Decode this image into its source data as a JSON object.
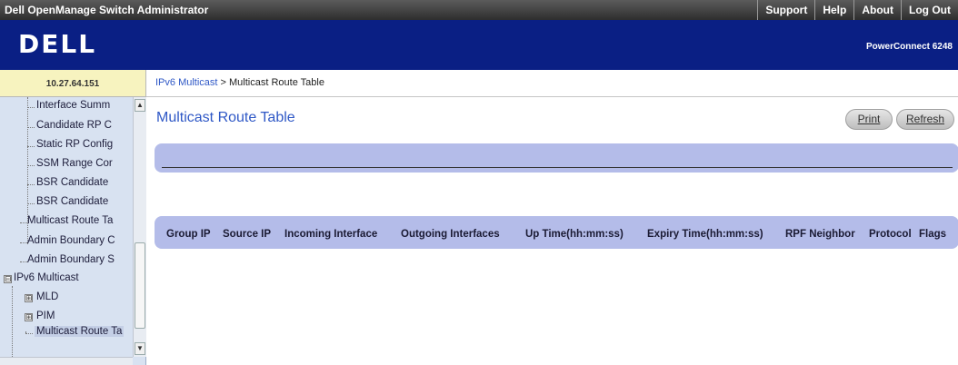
{
  "app_title": "Dell OpenManage Switch Administrator",
  "top_nav": [
    "Support",
    "Help",
    "About",
    "Log Out"
  ],
  "brand": {
    "logo": "DELL",
    "model": "PowerConnect 6248"
  },
  "ip_address": "10.27.64.151",
  "breadcrumb": {
    "parent": "IPv6 Multicast",
    "separator": " > ",
    "current": "Multicast Route Table"
  },
  "tree": {
    "items": [
      {
        "label": "Interface Summ"
      },
      {
        "label": "Candidate RP C"
      },
      {
        "label": "Static RP Config"
      },
      {
        "label": "SSM Range Cor"
      },
      {
        "label": "BSR Candidate"
      },
      {
        "label": "BSR Candidate"
      },
      {
        "label": "Multicast Route Ta"
      },
      {
        "label": "Admin Boundary C"
      },
      {
        "label": "Admin Boundary S"
      },
      {
        "label": "IPv6 Multicast",
        "expander": "⊟"
      },
      {
        "label": "MLD",
        "expander": "⊞"
      },
      {
        "label": "PIM",
        "expander": "⊞"
      },
      {
        "label": "Multicast Route Ta",
        "selected": true
      }
    ]
  },
  "main": {
    "title": "Multicast Route Table",
    "print_label": "Print",
    "refresh_label": "Refresh",
    "table_columns": [
      "Group IP",
      "Source IP",
      "Incoming Interface",
      "Outgoing Interfaces",
      "Up Time(hh:mm:ss)",
      "Expiry Time(hh:mm:ss)",
      "RPF Neighbor",
      "Protocol",
      "Flags"
    ]
  },
  "colors": {
    "banner": "#0a1f84",
    "link": "#2f58c6",
    "panel": "#b4bce9",
    "tree_bg": "#d8e2f1"
  }
}
